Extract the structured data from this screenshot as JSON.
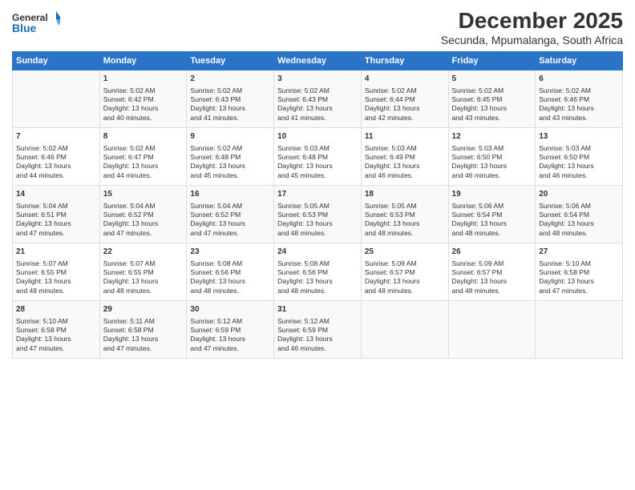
{
  "header": {
    "logo_line1": "General",
    "logo_line2": "Blue",
    "title": "December 2025",
    "subtitle": "Secunda, Mpumalanga, South Africa"
  },
  "columns": [
    "Sunday",
    "Monday",
    "Tuesday",
    "Wednesday",
    "Thursday",
    "Friday",
    "Saturday"
  ],
  "weeks": [
    [
      {
        "day": "",
        "info": ""
      },
      {
        "day": "1",
        "info": "Sunrise: 5:02 AM\nSunset: 6:42 PM\nDaylight: 13 hours\nand 40 minutes."
      },
      {
        "day": "2",
        "info": "Sunrise: 5:02 AM\nSunset: 6:43 PM\nDaylight: 13 hours\nand 41 minutes."
      },
      {
        "day": "3",
        "info": "Sunrise: 5:02 AM\nSunset: 6:43 PM\nDaylight: 13 hours\nand 41 minutes."
      },
      {
        "day": "4",
        "info": "Sunrise: 5:02 AM\nSunset: 6:44 PM\nDaylight: 13 hours\nand 42 minutes."
      },
      {
        "day": "5",
        "info": "Sunrise: 5:02 AM\nSunset: 6:45 PM\nDaylight: 13 hours\nand 43 minutes."
      },
      {
        "day": "6",
        "info": "Sunrise: 5:02 AM\nSunset: 6:46 PM\nDaylight: 13 hours\nand 43 minutes."
      }
    ],
    [
      {
        "day": "7",
        "info": "Sunrise: 5:02 AM\nSunset: 6:46 PM\nDaylight: 13 hours\nand 44 minutes."
      },
      {
        "day": "8",
        "info": "Sunrise: 5:02 AM\nSunset: 6:47 PM\nDaylight: 13 hours\nand 44 minutes."
      },
      {
        "day": "9",
        "info": "Sunrise: 5:02 AM\nSunset: 6:48 PM\nDaylight: 13 hours\nand 45 minutes."
      },
      {
        "day": "10",
        "info": "Sunrise: 5:03 AM\nSunset: 6:48 PM\nDaylight: 13 hours\nand 45 minutes."
      },
      {
        "day": "11",
        "info": "Sunrise: 5:03 AM\nSunset: 6:49 PM\nDaylight: 13 hours\nand 46 minutes."
      },
      {
        "day": "12",
        "info": "Sunrise: 5:03 AM\nSunset: 6:50 PM\nDaylight: 13 hours\nand 46 minutes."
      },
      {
        "day": "13",
        "info": "Sunrise: 5:03 AM\nSunset: 6:50 PM\nDaylight: 13 hours\nand 46 minutes."
      }
    ],
    [
      {
        "day": "14",
        "info": "Sunrise: 5:04 AM\nSunset: 6:51 PM\nDaylight: 13 hours\nand 47 minutes."
      },
      {
        "day": "15",
        "info": "Sunrise: 5:04 AM\nSunset: 6:52 PM\nDaylight: 13 hours\nand 47 minutes."
      },
      {
        "day": "16",
        "info": "Sunrise: 5:04 AM\nSunset: 6:52 PM\nDaylight: 13 hours\nand 47 minutes."
      },
      {
        "day": "17",
        "info": "Sunrise: 5:05 AM\nSunset: 6:53 PM\nDaylight: 13 hours\nand 48 minutes."
      },
      {
        "day": "18",
        "info": "Sunrise: 5:05 AM\nSunset: 6:53 PM\nDaylight: 13 hours\nand 48 minutes."
      },
      {
        "day": "19",
        "info": "Sunrise: 5:06 AM\nSunset: 6:54 PM\nDaylight: 13 hours\nand 48 minutes."
      },
      {
        "day": "20",
        "info": "Sunrise: 5:06 AM\nSunset: 6:54 PM\nDaylight: 13 hours\nand 48 minutes."
      }
    ],
    [
      {
        "day": "21",
        "info": "Sunrise: 5:07 AM\nSunset: 6:55 PM\nDaylight: 13 hours\nand 48 minutes."
      },
      {
        "day": "22",
        "info": "Sunrise: 5:07 AM\nSunset: 6:55 PM\nDaylight: 13 hours\nand 48 minutes."
      },
      {
        "day": "23",
        "info": "Sunrise: 5:08 AM\nSunset: 6:56 PM\nDaylight: 13 hours\nand 48 minutes."
      },
      {
        "day": "24",
        "info": "Sunrise: 5:08 AM\nSunset: 6:56 PM\nDaylight: 13 hours\nand 48 minutes."
      },
      {
        "day": "25",
        "info": "Sunrise: 5:09 AM\nSunset: 6:57 PM\nDaylight: 13 hours\nand 48 minutes."
      },
      {
        "day": "26",
        "info": "Sunrise: 5:09 AM\nSunset: 6:57 PM\nDaylight: 13 hours\nand 48 minutes."
      },
      {
        "day": "27",
        "info": "Sunrise: 5:10 AM\nSunset: 6:58 PM\nDaylight: 13 hours\nand 47 minutes."
      }
    ],
    [
      {
        "day": "28",
        "info": "Sunrise: 5:10 AM\nSunset: 6:58 PM\nDaylight: 13 hours\nand 47 minutes."
      },
      {
        "day": "29",
        "info": "Sunrise: 5:11 AM\nSunset: 6:58 PM\nDaylight: 13 hours\nand 47 minutes."
      },
      {
        "day": "30",
        "info": "Sunrise: 5:12 AM\nSunset: 6:59 PM\nDaylight: 13 hours\nand 47 minutes."
      },
      {
        "day": "31",
        "info": "Sunrise: 5:12 AM\nSunset: 6:59 PM\nDaylight: 13 hours\nand 46 minutes."
      },
      {
        "day": "",
        "info": ""
      },
      {
        "day": "",
        "info": ""
      },
      {
        "day": "",
        "info": ""
      }
    ]
  ]
}
